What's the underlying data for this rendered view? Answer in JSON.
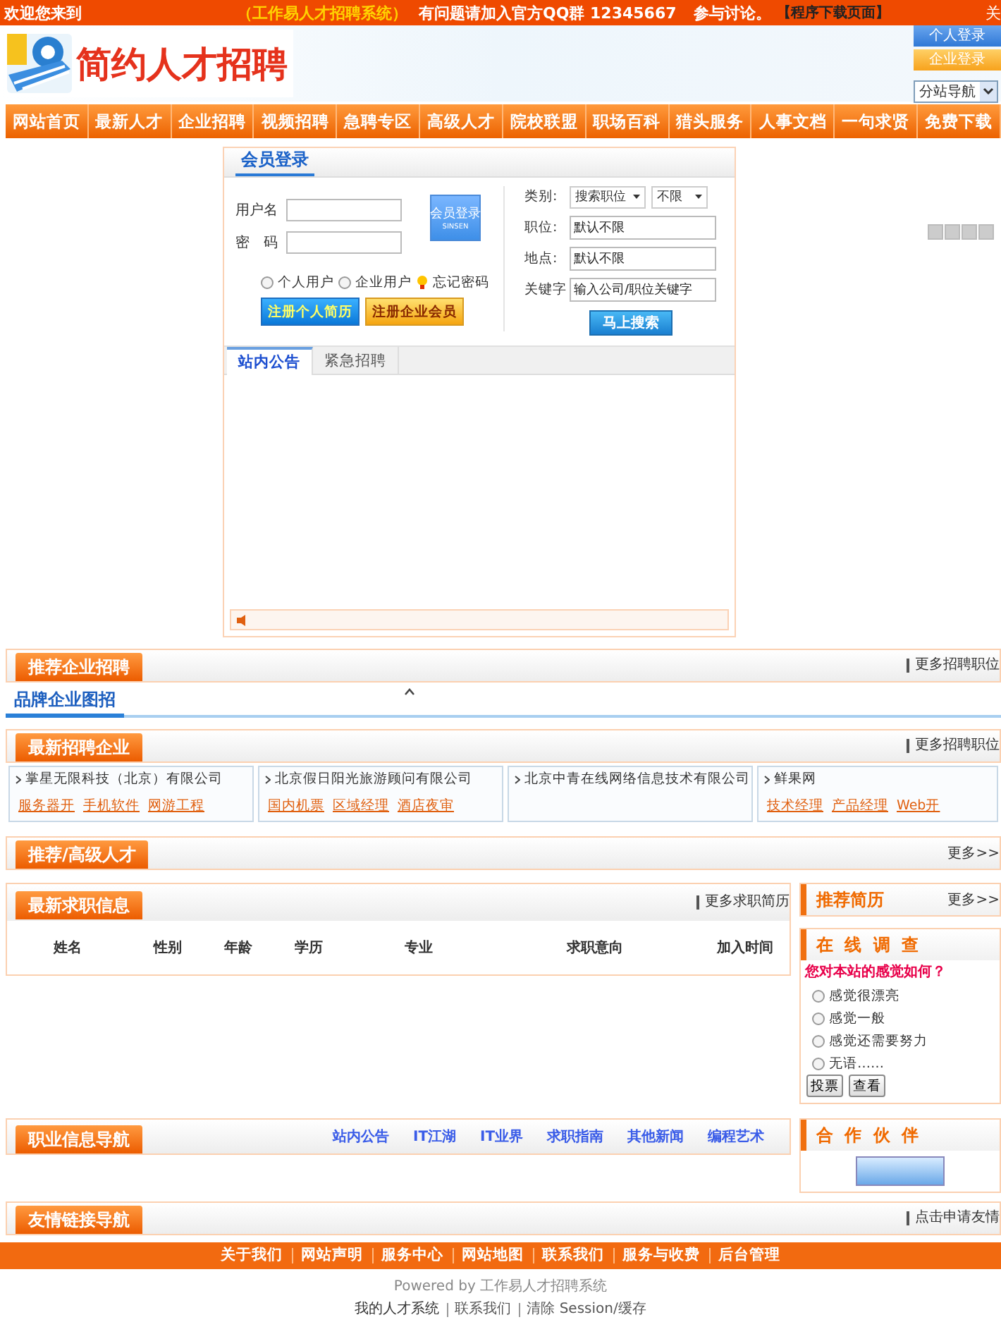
{
  "top_bar": {
    "welcome": "欢迎您来到",
    "system_name": "（工作易人才招聘系统）",
    "notice": "有问题请加入官方QQ群 12345667",
    "discuss": "参与讨论。",
    "download_link": "【程序下载页面】",
    "edge_text": "关"
  },
  "header": {
    "logo_text": "简约人才招聘",
    "login_buttons": [
      {
        "label": "个人登录",
        "kind": "personal"
      },
      {
        "label": "企业登录",
        "kind": "company"
      }
    ],
    "site_select": "分站导航"
  },
  "nav": [
    "网站首页",
    "最新人才",
    "企业招聘",
    "视频招聘",
    "急聘专区",
    "高级人才",
    "院校联盟",
    "职场百科",
    "猎头服务",
    "人事文档",
    "一句求贤",
    "免费下载"
  ],
  "login": {
    "title": "会员登录",
    "username_label": "用户名",
    "password_label": "密码",
    "login_button": "会员登录",
    "login_button_sub": "SINSEN",
    "user_types": [
      {
        "label": "个人用户",
        "selected": false
      },
      {
        "label": "企业用户",
        "selected": false
      }
    ],
    "forgot": "忘记密码",
    "register_buttons": [
      {
        "label": "注册个人简历",
        "kind": "personal"
      },
      {
        "label": "注册企业会员",
        "kind": "company"
      }
    ]
  },
  "search": {
    "category_label": "类别:",
    "category": "搜索职位",
    "range": "不限",
    "position_label": "职位:",
    "position": "默认不限",
    "location_label": "地点:",
    "location": "默认不限",
    "keyword_label": "关键字",
    "keyword_placeholder": "输入公司/职位关键字",
    "button": "马上搜索"
  },
  "notice_tabs": [
    {
      "label": "站内公告",
      "selected": true
    },
    {
      "label": "紧急招聘",
      "selected": false
    }
  ],
  "recommend_companies": {
    "title": "推荐企业招聘",
    "more": "更多招聘职位"
  },
  "brand_tab": {
    "label": "品牌企业图招",
    "selected": true
  },
  "latest_companies": {
    "title": "最新招聘企业",
    "more": "更多招聘职位",
    "items": [
      {
        "name": "掌星无限科技（北京）有限公司",
        "jobs": [
          "服务器开",
          "手机软件",
          "网游工程"
        ]
      },
      {
        "name": "北京假日阳光旅游顾问有限公司",
        "jobs": [
          "国内机票",
          "区域经理",
          "酒店夜审"
        ]
      },
      {
        "name": "北京中青在线网络信息技术有限公司"
      },
      {
        "name": "鲜果网",
        "jobs": [
          "技术经理",
          "产品经理",
          "Web开"
        ]
      }
    ]
  },
  "senior_talent": {
    "title": "推荐/高级人才",
    "more": "更多>>"
  },
  "resumes": {
    "title": "最新求职信息",
    "more": "更多求职简历",
    "columns": [
      "姓名",
      "性别",
      "年龄",
      "学历",
      "专业",
      "求职意向",
      "加入时间"
    ]
  },
  "recommended_resumes": {
    "title": "推荐简历",
    "more": "更多>>"
  },
  "survey": {
    "title": "在 线 调 查",
    "question": "您对本站的感觉如何？",
    "options": [
      {
        "label": "感觉很漂亮",
        "selected": false
      },
      {
        "label": "感觉一般",
        "selected": false
      },
      {
        "label": "感觉还需要努力",
        "selected": false
      },
      {
        "label": "无语……",
        "selected": false
      }
    ],
    "buttons": [
      "投票",
      "查看"
    ]
  },
  "career_nav": {
    "title": "职业信息导航",
    "links": [
      "站内公告",
      "IT江湖",
      "IT业界",
      "求职指南",
      "其他新闻",
      "编程艺术"
    ]
  },
  "partners": {
    "title": "合 作 伙 伴"
  },
  "friend_links": {
    "title": "友情链接导航",
    "more": "点击申请友情"
  },
  "footer": {
    "links": [
      "关于我们",
      "网站声明",
      "服务中心",
      "网站地图",
      "联系我们",
      "服务与收费",
      "后台管理"
    ],
    "powered": "Powered by 工作易人才招聘系统",
    "bottom_links": [
      "我的人才系统",
      "联系我们",
      "清除 Session/缓存"
    ]
  }
}
